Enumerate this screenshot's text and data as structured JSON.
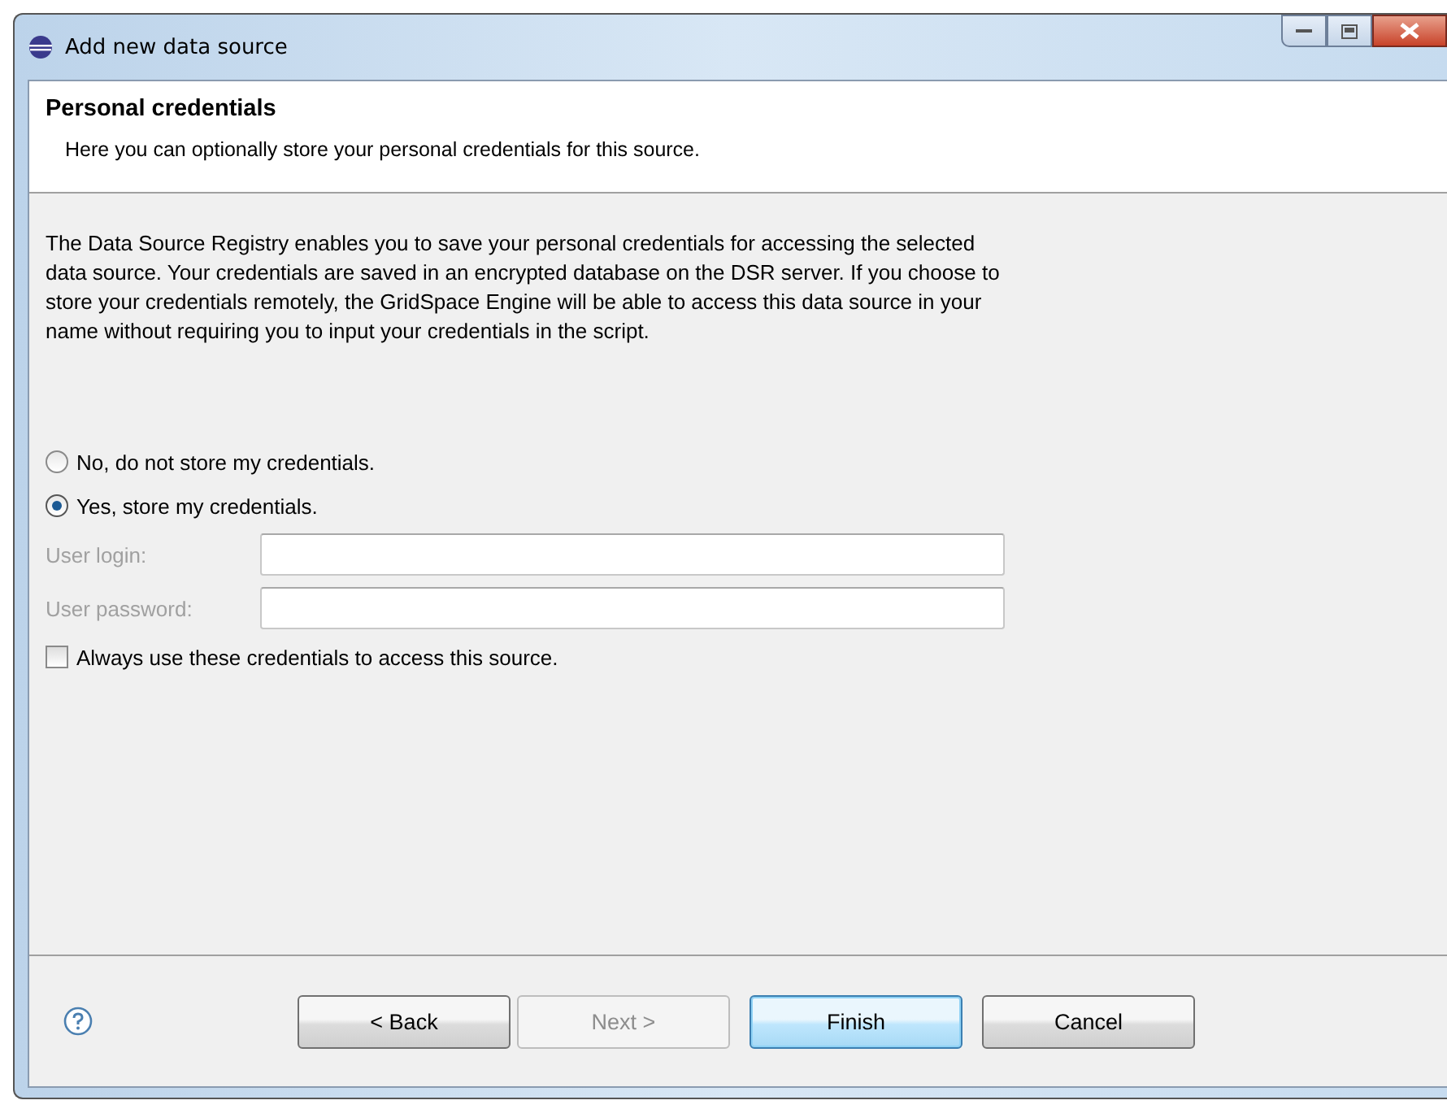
{
  "window": {
    "title": "Add new data source"
  },
  "header": {
    "title": "Personal credentials",
    "subtitle": "Here you can optionally store your personal credentials for this source."
  },
  "description": "The Data Source Registry enables you to save your personal credentials for accessing the selected data source. Your credentials are saved in an encrypted database on the DSR server. If you choose to store your credentials remotely, the GridSpace Engine will be able to access this data source in your name without requiring you to input your credentials in the script.",
  "options": [
    {
      "label": "No, do not store my credentials.",
      "selected": false
    },
    {
      "label": "Yes, store my credentials.",
      "selected": true
    }
  ],
  "fields": [
    {
      "label": "User login:",
      "disabled": true
    },
    {
      "label": "User password:",
      "disabled": true
    }
  ],
  "checkbox": {
    "label": "Always use these credentials to access this source.",
    "checked": false
  },
  "buttons": [
    {
      "label": "< Back",
      "disabled": false,
      "default": false
    },
    {
      "label": "Next >",
      "disabled": true,
      "default": false
    },
    {
      "label": "Finish",
      "disabled": false,
      "default": true
    },
    {
      "label": "Cancel",
      "disabled": false,
      "default": false
    }
  ]
}
